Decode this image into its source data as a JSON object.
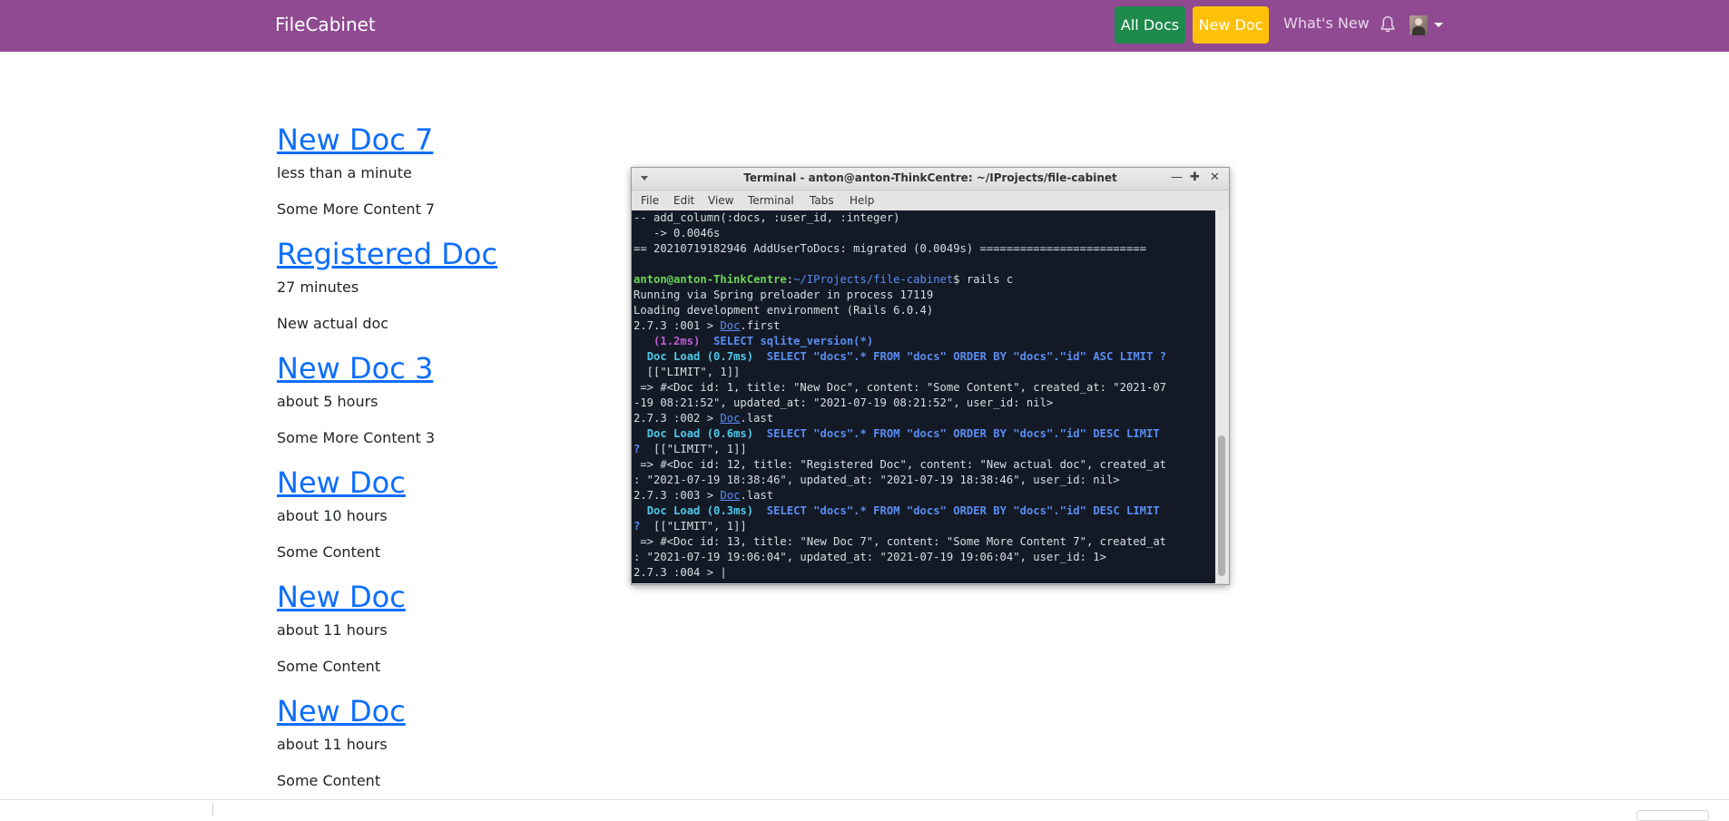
{
  "navbar": {
    "brand": "FileCabinet",
    "all_docs": "All Docs",
    "new_doc": "New Doc",
    "whats_new": "What's New",
    "bell_icon": "bell-icon",
    "avatar_icon": "user-avatar",
    "colors": {
      "bg": "#8f4a92",
      "all_docs_bg": "#1e8a4c",
      "new_doc_bg": "#ffc107"
    }
  },
  "docs": [
    {
      "title": "New Doc 7",
      "time": "less than a minute",
      "content": "Some More Content 7"
    },
    {
      "title": "Registered Doc",
      "time": "27 minutes",
      "content": "New actual doc"
    },
    {
      "title": "New Doc 3",
      "time": "about 5 hours",
      "content": "Some More Content 3"
    },
    {
      "title": "New Doc",
      "time": "about 10 hours",
      "content": "Some Content"
    },
    {
      "title": "New Doc",
      "time": "about 11 hours",
      "content": "Some Content"
    },
    {
      "title": "New Doc",
      "time": "about 11 hours",
      "content": "Some Content"
    }
  ],
  "terminal": {
    "title": "Terminal - anton@anton-ThinkCentre: ~/IProjects/file-cabinet",
    "menu": [
      "File",
      "Edit",
      "View",
      "Terminal",
      "Tabs",
      "Help"
    ],
    "lines": [
      [
        {
          "t": "-- add_column(:docs, :user_id, :integer)"
        }
      ],
      [
        {
          "t": "   -> 0.0046s"
        }
      ],
      [
        {
          "t": "== 20210719182946 AddUserToDocs: migrated (0.0049s) ========================="
        }
      ],
      [
        {
          "t": ""
        }
      ],
      [
        {
          "t": "anton@anton-ThinkCentre",
          "c": "c-green"
        },
        {
          "t": ":"
        },
        {
          "t": "~/IProjects/file-cabinet",
          "c": "c-blue"
        },
        {
          "t": "$ rails c"
        }
      ],
      [
        {
          "t": "Running via Spring preloader in process 17119"
        }
      ],
      [
        {
          "t": "Loading development environment (Rails 6.0.4)"
        }
      ],
      [
        {
          "t": "2.7.3 :001 > "
        },
        {
          "t": "Doc",
          "c": "c-link"
        },
        {
          "t": ".first"
        }
      ],
      [
        {
          "t": "   "
        },
        {
          "t": "(1.2ms)",
          "c": "c-mag"
        },
        {
          "t": "  "
        },
        {
          "t": "SELECT sqlite_version(*)",
          "c": "c-bblue"
        }
      ],
      [
        {
          "t": "  "
        },
        {
          "t": "Doc Load (0.7ms)",
          "c": "c-cyan"
        },
        {
          "t": "  "
        },
        {
          "t": "SELECT \"docs\".* FROM \"docs\" ORDER BY \"docs\".\"id\" ASC LIMIT ?",
          "c": "c-bblue"
        }
      ],
      [
        {
          "t": "  [[\"LIMIT\", 1]]"
        }
      ],
      [
        {
          "t": " => #<Doc id: 1, title: \"New Doc\", content: \"Some Content\", created_at: \"2021-07"
        }
      ],
      [
        {
          "t": "-19 08:21:52\", updated_at: \"2021-07-19 08:21:52\", user_id: nil>"
        }
      ],
      [
        {
          "t": "2.7.3 :002 > "
        },
        {
          "t": "Doc",
          "c": "c-link"
        },
        {
          "t": ".last"
        }
      ],
      [
        {
          "t": "  "
        },
        {
          "t": "Doc Load (0.6ms)",
          "c": "c-cyan"
        },
        {
          "t": "  "
        },
        {
          "t": "SELECT \"docs\".* FROM \"docs\" ORDER BY \"docs\".\"id\" DESC LIMIT",
          "c": "c-bblue"
        }
      ],
      [
        {
          "t": "?",
          "c": "c-bblue"
        },
        {
          "t": "  [[\"LIMIT\", 1]]"
        }
      ],
      [
        {
          "t": " => #<Doc id: 12, title: \"Registered Doc\", content: \"New actual doc\", created_at"
        }
      ],
      [
        {
          "t": ": \"2021-07-19 18:38:46\", updated_at: \"2021-07-19 18:38:46\", user_id: nil>"
        }
      ],
      [
        {
          "t": "2.7.3 :003 > "
        },
        {
          "t": "Doc",
          "c": "c-link"
        },
        {
          "t": ".last"
        }
      ],
      [
        {
          "t": "  "
        },
        {
          "t": "Doc Load (0.3ms)",
          "c": "c-cyan"
        },
        {
          "t": "  "
        },
        {
          "t": "SELECT \"docs\".* FROM \"docs\" ORDER BY \"docs\".\"id\" DESC LIMIT",
          "c": "c-bblue"
        }
      ],
      [
        {
          "t": "?",
          "c": "c-bblue"
        },
        {
          "t": "  [[\"LIMIT\", 1]]"
        }
      ],
      [
        {
          "t": " => #<Doc id: 13, title: \"New Doc 7\", content: \"Some More Content 7\", created_at"
        }
      ],
      [
        {
          "t": ": \"2021-07-19 19:06:04\", updated_at: \"2021-07-19 19:06:04\", user_id: 1>"
        }
      ],
      [
        {
          "t": "2.7.3 :004 > |"
        }
      ]
    ]
  }
}
